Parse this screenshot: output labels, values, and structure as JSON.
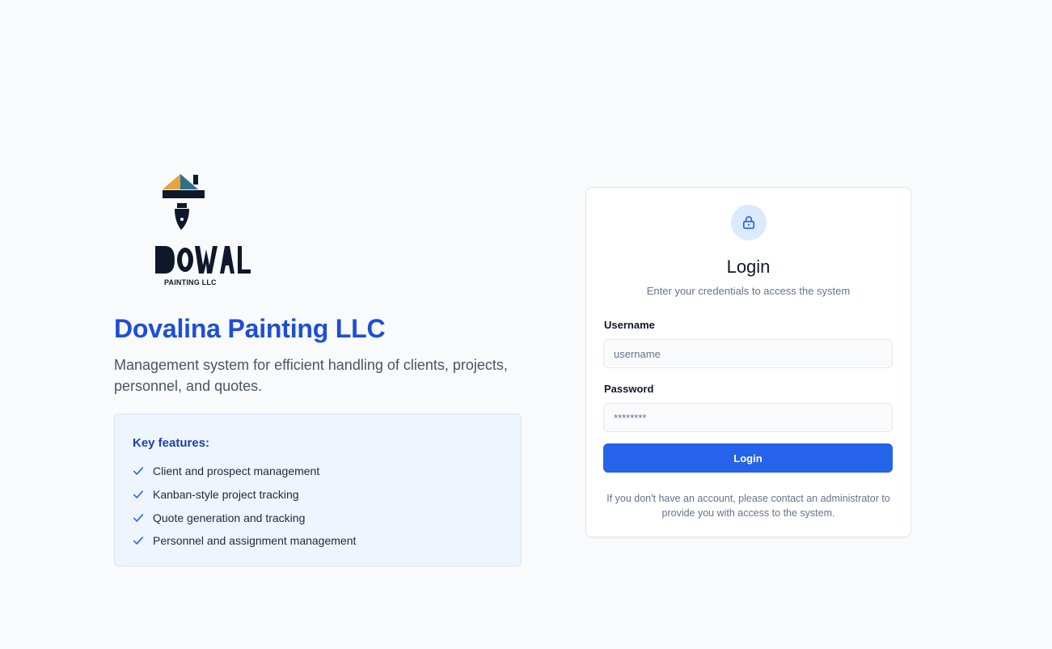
{
  "brand": {
    "logo_text": "DOVAL",
    "logo_subtext": "PAINTING LLC",
    "title": "Dovalina Painting LLC",
    "description": "Management system for efficient handling of clients, projects, personnel, and quotes."
  },
  "features": {
    "title": "Key features:",
    "items": [
      "Client and prospect management",
      "Kanban-style project tracking",
      "Quote generation and tracking",
      "Personnel and assignment management"
    ]
  },
  "login": {
    "icon": "lock-icon",
    "title": "Login",
    "subtitle": "Enter your credentials to access the system",
    "username_label": "Username",
    "username_placeholder": "username",
    "password_label": "Password",
    "password_placeholder": "********",
    "button_label": "Login",
    "note": "If you don't have an account, please contact an administrator to provide you with access to the system."
  },
  "colors": {
    "accent": "#2563eb",
    "brand_title": "#1d4ed8",
    "features_bg": "#eef5ff",
    "logo_orange": "#e8a33a",
    "logo_teal": "#2f6f87"
  }
}
